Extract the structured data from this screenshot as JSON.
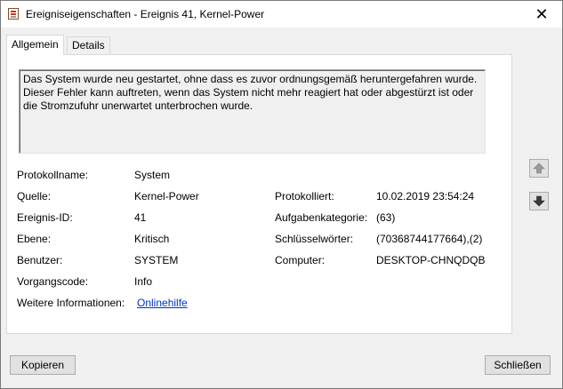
{
  "window": {
    "title": "Ereigniseigenschaften - Ereignis 41, Kernel-Power",
    "close_glyph": "✕"
  },
  "tabs": [
    {
      "label": "Allgemein",
      "active": true
    },
    {
      "label": "Details",
      "active": false
    }
  ],
  "description": "Das System wurde neu gestartet, ohne dass es zuvor ordnungsgemäß heruntergefahren wurde. Dieser Fehler kann auftreten, wenn das System nicht mehr reagiert hat oder abgestürzt ist oder die Stromzufuhr unerwartet unterbrochen wurde.",
  "fields": {
    "protokollname": {
      "label": "Protokollname:",
      "value": "System"
    },
    "quelle": {
      "label": "Quelle:",
      "value": "Kernel-Power"
    },
    "ereignis_id": {
      "label": "Ereignis-ID:",
      "value": "41"
    },
    "ebene": {
      "label": "Ebene:",
      "value": "Kritisch"
    },
    "benutzer": {
      "label": "Benutzer:",
      "value": "SYSTEM"
    },
    "vorgangscode": {
      "label": "Vorgangscode:",
      "value": "Info"
    },
    "weitere": {
      "label": "Weitere Informationen:",
      "link": "Onlinehilfe"
    },
    "protokolliert": {
      "label": "Protokolliert:",
      "value": "10.02.2019 23:54:24"
    },
    "aufgabenkategorie": {
      "label": "Aufgabenkategorie:",
      "value": "(63)"
    },
    "schluesselwoerter": {
      "label": "Schlüsselwörter:",
      "value": "(70368744177664),(2)"
    },
    "computer": {
      "label": "Computer:",
      "value": "DESKTOP-CHNQDQB"
    }
  },
  "nav": {
    "up_icon": "arrow-up-icon",
    "down_icon": "arrow-down-icon"
  },
  "buttons": {
    "copy": "Kopieren",
    "close": "Schließen"
  }
}
